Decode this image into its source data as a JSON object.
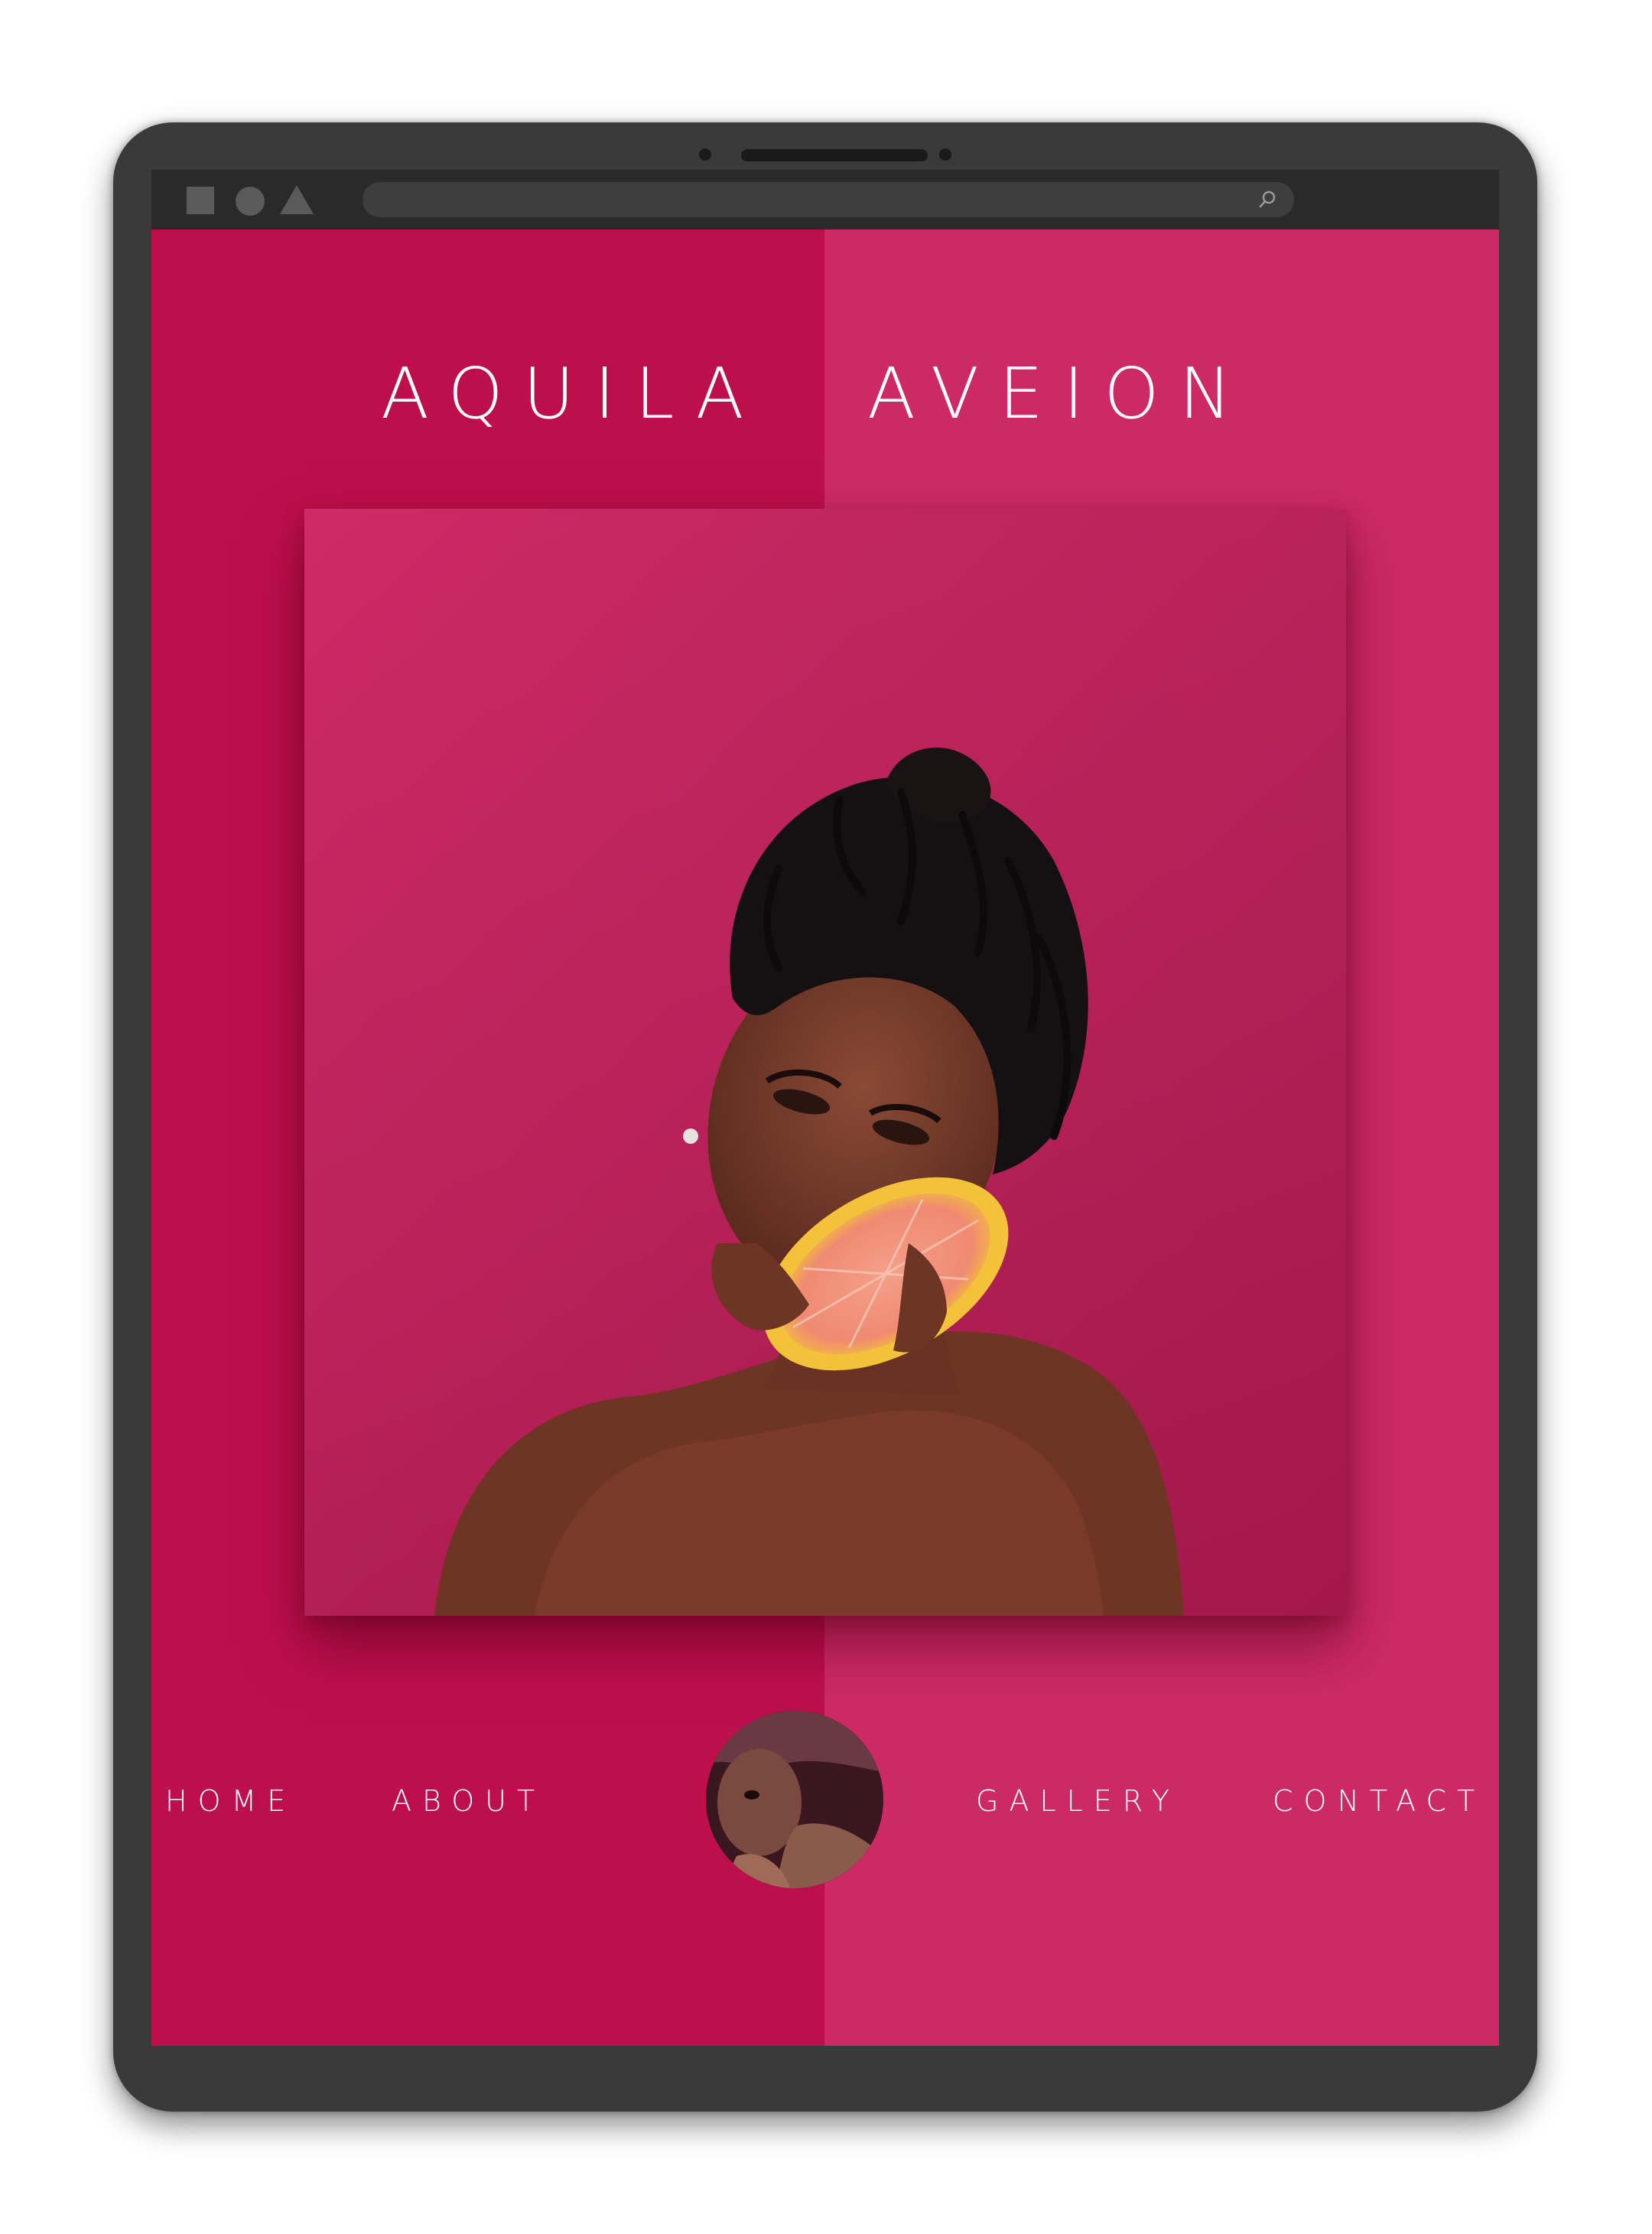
{
  "browser": {
    "window_controls": [
      "square-icon",
      "circle-icon",
      "triangle-icon"
    ],
    "address_placeholder": "",
    "search_icon": "search-icon"
  },
  "site": {
    "title_first": "AQUILA",
    "title_last": "AVEION"
  },
  "hero": {
    "image_icon": "portrait-photo"
  },
  "nav": {
    "home": "HOME",
    "about": "ABOUT",
    "gallery": "GALLERY",
    "contact": "CONTACT"
  },
  "logo": {
    "icon": "avatar-photo"
  },
  "colors": {
    "left_panel": "#bd0f4c",
    "right_panel": "#cd2a65",
    "frame": "#3a3a3a",
    "text": "#ffffff"
  }
}
